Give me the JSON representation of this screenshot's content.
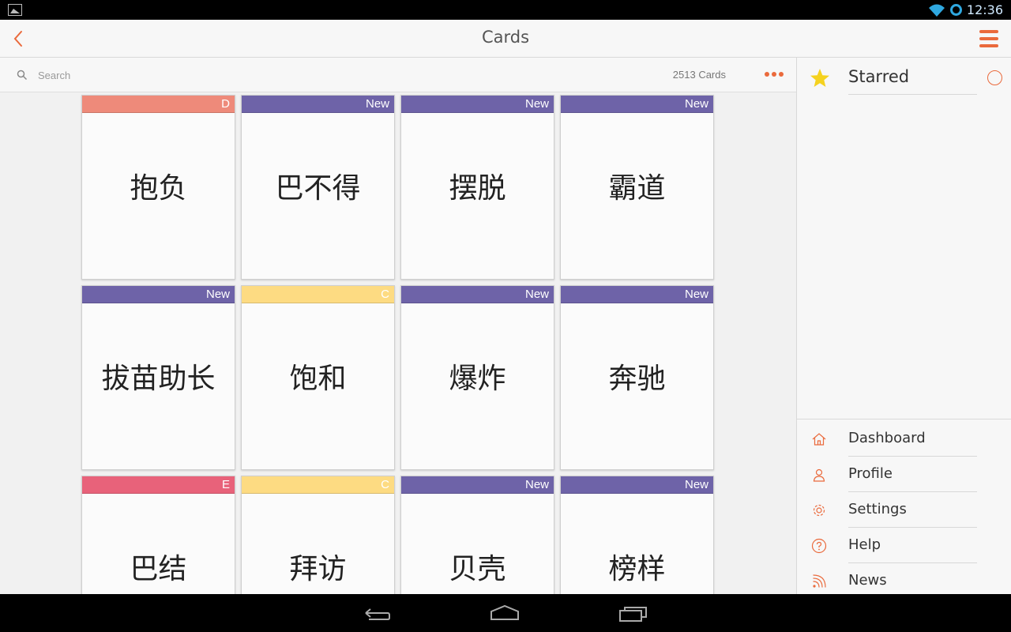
{
  "status_bar": {
    "time": "12:36"
  },
  "app_bar": {
    "title": "Cards"
  },
  "search": {
    "placeholder": "Search",
    "count": "2513 Cards"
  },
  "cards": [
    {
      "tag": "D",
      "word": "抱负",
      "color": "#ee8a7a"
    },
    {
      "tag": "New",
      "word": "巴不得",
      "color": "#6e63a8"
    },
    {
      "tag": "New",
      "word": "摆脱",
      "color": "#6e63a8"
    },
    {
      "tag": "New",
      "word": "霸道",
      "color": "#6e63a8"
    },
    {
      "tag": "New",
      "word": "拔苗助长",
      "color": "#6e63a8"
    },
    {
      "tag": "C",
      "word": "饱和",
      "color": "#fddb82"
    },
    {
      "tag": "New",
      "word": "爆炸",
      "color": "#6e63a8"
    },
    {
      "tag": "New",
      "word": "奔驰",
      "color": "#6e63a8"
    },
    {
      "tag": "E",
      "word": "巴结",
      "color": "#e8627a"
    },
    {
      "tag": "C",
      "word": "拜访",
      "color": "#fddb82"
    },
    {
      "tag": "New",
      "word": "贝壳",
      "color": "#6e63a8"
    },
    {
      "tag": "New",
      "word": "榜样",
      "color": "#6e63a8"
    }
  ],
  "panel": {
    "starred_label": "Starred",
    "nav": [
      {
        "label": "Dashboard",
        "icon": "home-icon"
      },
      {
        "label": "Profile",
        "icon": "person-icon"
      },
      {
        "label": "Settings",
        "icon": "gear-icon"
      },
      {
        "label": "Help",
        "icon": "help-icon"
      },
      {
        "label": "News",
        "icon": "rss-icon"
      }
    ]
  },
  "colors": {
    "accent": "#ea6a3c",
    "star": "#f5d21f"
  }
}
